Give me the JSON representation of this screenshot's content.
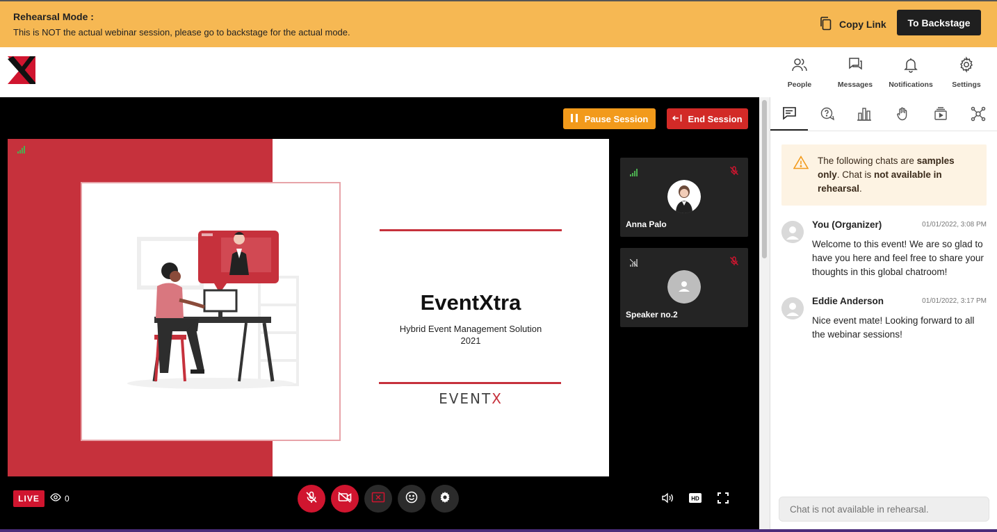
{
  "banner": {
    "title": "Rehearsal Mode :",
    "description": "This is NOT the actual webinar session, please go to backstage for the actual mode.",
    "copy_link": "Copy Link",
    "to_backstage": "To Backstage"
  },
  "nav": {
    "people": "People",
    "messages": "Messages",
    "notifications": "Notifications",
    "settings": "Settings"
  },
  "session": {
    "pause": "Pause Session",
    "end": "End Session"
  },
  "slide": {
    "title": "EventXtra",
    "subtitle_line1": "Hybrid Event Management Solution",
    "subtitle_line2": "2021",
    "brand_main": "EVENT",
    "brand_x": "X"
  },
  "speakers": [
    {
      "name": "Anna Palo"
    },
    {
      "name": "Speaker no.2"
    }
  ],
  "stage_bar": {
    "live": "LIVE",
    "viewers": "0"
  },
  "chat": {
    "notice_part1": "The following chats are ",
    "notice_bold1": "samples only",
    "notice_part2": ". Chat is ",
    "notice_bold2": "not available in rehearsal",
    "notice_part3": ".",
    "messages": [
      {
        "name": "You (Organizer)",
        "time": "01/01/2022, 3:08 PM",
        "text": "Welcome to this event! We are so glad to have you here and feel free to share your thoughts in this global chatroom!"
      },
      {
        "name": "Eddie Anderson",
        "time": "01/01/2022, 3:17 PM",
        "text": "Nice event mate! Looking forward to all the webinar sessions!"
      }
    ],
    "input_placeholder": "Chat is not available in rehearsal."
  },
  "colors": {
    "banner": "#f6b853",
    "pause": "#f29a1b",
    "end": "#d22a27",
    "live": "#d0152f",
    "slide_red": "#c6313c"
  }
}
